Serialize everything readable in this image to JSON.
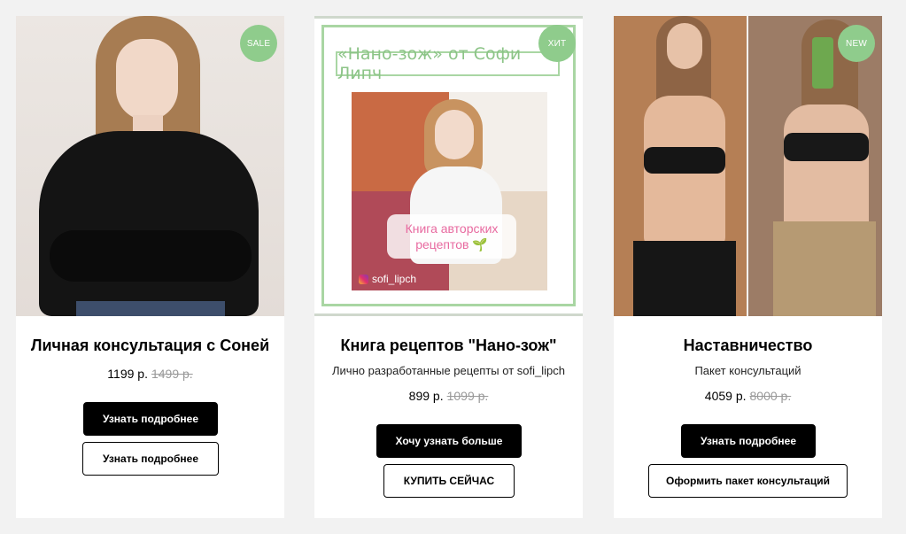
{
  "products": [
    {
      "badge": "SALE",
      "title": "Личная консультация с Соней",
      "subtitle": "",
      "price": "1199 р.",
      "old_price": "1499 р.",
      "primary_button": "Узнать подробнее",
      "secondary_button": "Узнать подробнее"
    },
    {
      "badge": "ХИТ",
      "title": "Книга рецептов \"Нано-зож\"",
      "subtitle": "Лично разработанные рецепты от sofi_lipch",
      "price": "899 р.",
      "old_price": "1099 р.",
      "primary_button": "Хочу узнать больше",
      "secondary_button": "КУПИТЬ СЕЙЧАС",
      "cover": {
        "banner": "«Нано-зож» от Софи Липч",
        "label_line1": "Книга авторских",
        "label_line2": "рецептов 🌱",
        "instagram": "sofi_lipch"
      }
    },
    {
      "badge": "NEW",
      "title": "Наставничество",
      "subtitle": "Пакет консультаций",
      "price": "4059 р.",
      "old_price": "8000 р.",
      "primary_button": "Узнать подробнее",
      "secondary_button": "Оформить пакет консультаций"
    }
  ],
  "colors": {
    "badge": "#8fcc8c",
    "button_dark": "#000000",
    "page_bg": "#f2f2f2",
    "card_bg": "#ffffff"
  }
}
